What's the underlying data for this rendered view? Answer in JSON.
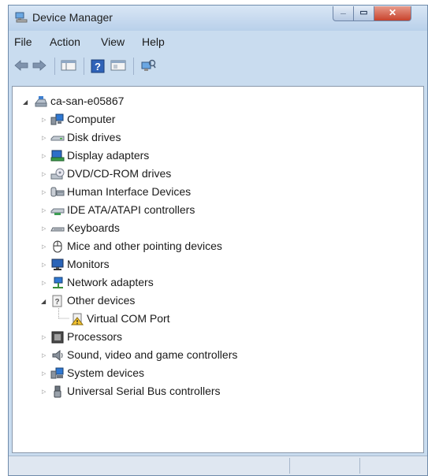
{
  "window": {
    "title": "Device Manager"
  },
  "menubar": {
    "items": [
      "File",
      "Action",
      "View",
      "Help"
    ]
  },
  "toolbar": {
    "icons": [
      "back-arrow-icon",
      "forward-arrow-icon",
      "show-hide-console-tree-icon",
      "help-icon",
      "properties-icon",
      "scan-hardware-icon"
    ]
  },
  "tree": {
    "root": "ca-san-e05867",
    "categories": [
      {
        "label": "Computer",
        "icon": "computer-icon",
        "expanded": false
      },
      {
        "label": "Disk drives",
        "icon": "disk-drive-icon",
        "expanded": false
      },
      {
        "label": "Display adapters",
        "icon": "display-adapter-icon",
        "expanded": false
      },
      {
        "label": "DVD/CD-ROM drives",
        "icon": "dvd-drive-icon",
        "expanded": false
      },
      {
        "label": "Human Interface Devices",
        "icon": "hid-icon",
        "expanded": false
      },
      {
        "label": "IDE ATA/ATAPI controllers",
        "icon": "ide-controller-icon",
        "expanded": false
      },
      {
        "label": "Keyboards",
        "icon": "keyboard-icon",
        "expanded": false
      },
      {
        "label": "Mice and other pointing devices",
        "icon": "mouse-icon",
        "expanded": false
      },
      {
        "label": "Monitors",
        "icon": "monitor-icon",
        "expanded": false
      },
      {
        "label": "Network adapters",
        "icon": "network-adapter-icon",
        "expanded": false
      },
      {
        "label": "Other devices",
        "icon": "other-devices-icon",
        "expanded": true,
        "children": [
          {
            "label": "Virtual COM Port",
            "icon": "warning-device-icon"
          }
        ]
      },
      {
        "label": "Processors",
        "icon": "processor-icon",
        "expanded": false
      },
      {
        "label": "Sound, video and game controllers",
        "icon": "sound-icon",
        "expanded": false
      },
      {
        "label": "System devices",
        "icon": "system-device-icon",
        "expanded": false
      },
      {
        "label": "Universal Serial Bus controllers",
        "icon": "usb-icon",
        "expanded": false
      }
    ]
  },
  "colors": {
    "frame": "#c9dcef",
    "close_button": "#c8432d",
    "warning": "#f2c230"
  }
}
